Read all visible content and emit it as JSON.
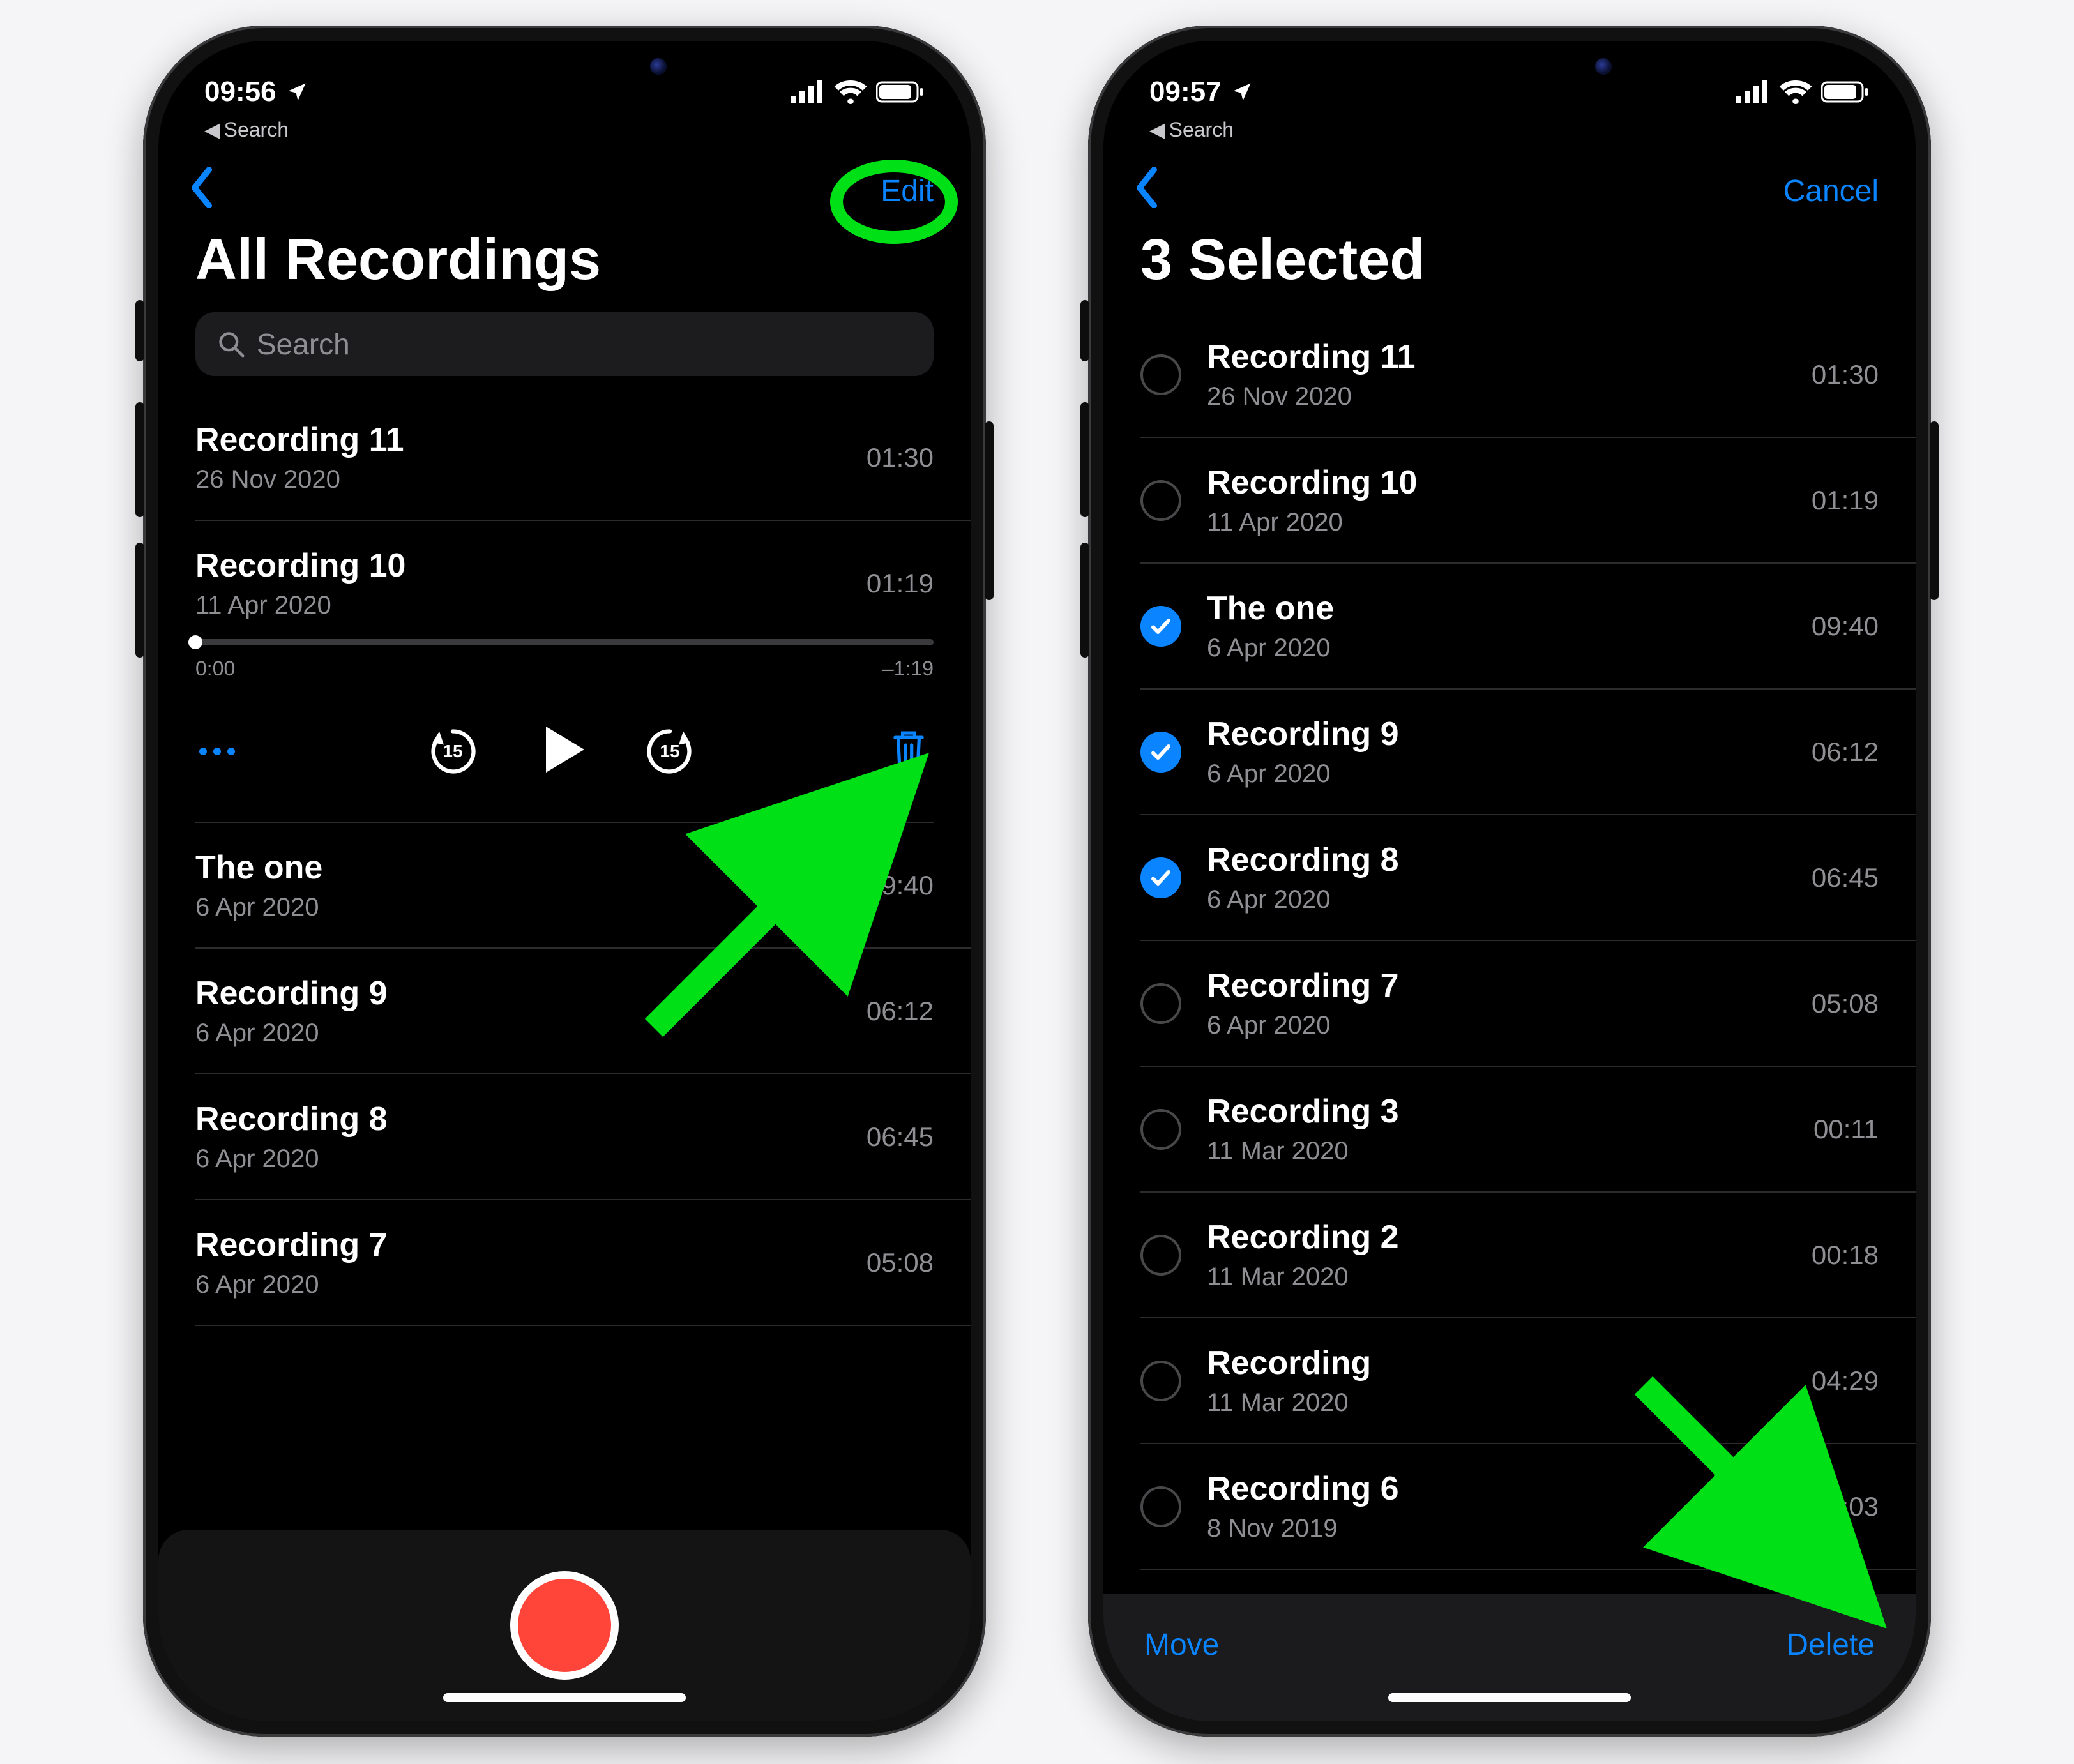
{
  "status": {
    "left_time": "09:56",
    "right_time": "09:57",
    "back_app": "Search"
  },
  "left": {
    "nav_action": "Edit",
    "title": "All Recordings",
    "search_placeholder": "Search",
    "progress_start": "0:00",
    "progress_end": "–1:19",
    "skip_seconds": "15",
    "items": [
      {
        "title": "Recording 11",
        "date": "26 Nov 2020",
        "dur": "01:30",
        "expanded": false
      },
      {
        "title": "Recording 10",
        "date": "11 Apr 2020",
        "dur": "01:19",
        "expanded": true
      },
      {
        "title": "The one",
        "date": "6 Apr 2020",
        "dur": "09:40",
        "expanded": false
      },
      {
        "title": "Recording 9",
        "date": "6 Apr 2020",
        "dur": "06:12",
        "expanded": false
      },
      {
        "title": "Recording 8",
        "date": "6 Apr 2020",
        "dur": "06:45",
        "expanded": false
      },
      {
        "title": "Recording 7",
        "date": "6 Apr 2020",
        "dur": "05:08",
        "expanded": false
      }
    ]
  },
  "right": {
    "nav_action": "Cancel",
    "title": "3 Selected",
    "footer_move": "Move",
    "footer_delete": "Delete",
    "items": [
      {
        "title": "Recording 11",
        "date": "26 Nov 2020",
        "dur": "01:30",
        "selected": false
      },
      {
        "title": "Recording 10",
        "date": "11 Apr 2020",
        "dur": "01:19",
        "selected": false
      },
      {
        "title": "The one",
        "date": "6 Apr 2020",
        "dur": "09:40",
        "selected": true
      },
      {
        "title": "Recording 9",
        "date": "6 Apr 2020",
        "dur": "06:12",
        "selected": true
      },
      {
        "title": "Recording 8",
        "date": "6 Apr 2020",
        "dur": "06:45",
        "selected": true
      },
      {
        "title": "Recording 7",
        "date": "6 Apr 2020",
        "dur": "05:08",
        "selected": false
      },
      {
        "title": "Recording 3",
        "date": "11 Mar 2020",
        "dur": "00:11",
        "selected": false
      },
      {
        "title": "Recording 2",
        "date": "11 Mar 2020",
        "dur": "00:18",
        "selected": false
      },
      {
        "title": "Recording",
        "date": "11 Mar 2020",
        "dur": "04:29",
        "selected": false
      },
      {
        "title": "Recording 6",
        "date": "8 Nov 2019",
        "dur": "01:03",
        "selected": false
      }
    ]
  }
}
